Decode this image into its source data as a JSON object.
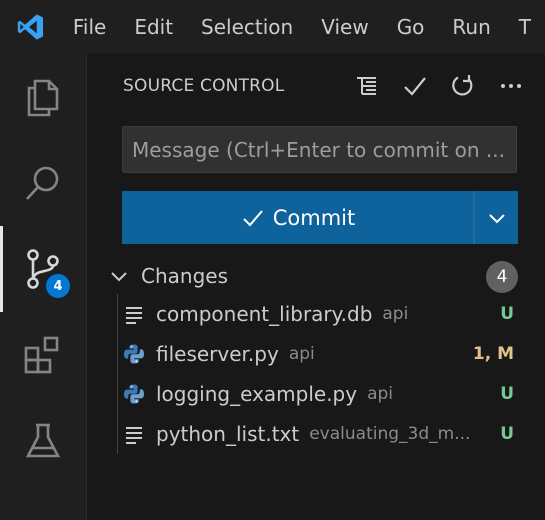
{
  "colors": {
    "accent": "#0e639c",
    "badge": "#0078d4",
    "untracked": "#73c991",
    "modified": "#e2c08d"
  },
  "menu": {
    "logo_icon": "vscode-logo-icon",
    "items": [
      "File",
      "Edit",
      "Selection",
      "View",
      "Go",
      "Run",
      "T"
    ]
  },
  "activity_bar": {
    "items": [
      {
        "icon": "files-icon"
      },
      {
        "icon": "search-icon"
      },
      {
        "icon": "source-control-icon",
        "badge": "4",
        "active": true
      },
      {
        "icon": "extensions-icon"
      },
      {
        "icon": "testing-icon"
      }
    ]
  },
  "sidebar": {
    "title": "SOURCE CONTROL",
    "tools": [
      "view-as-tree-icon",
      "commit-check-icon",
      "refresh-icon",
      "more-actions-icon"
    ],
    "message_placeholder": "Message (Ctrl+Enter to commit on ...",
    "commit_label": "Commit",
    "changes": {
      "label": "Changes",
      "count": "4",
      "files": [
        {
          "name": "component_library.db",
          "dir": "api",
          "status": "U",
          "icon": "text-file-icon"
        },
        {
          "name": "fileserver.py",
          "dir": "api",
          "status": "1, M",
          "icon": "python-file-icon"
        },
        {
          "name": "logging_example.py",
          "dir": "api",
          "status": "U",
          "icon": "python-file-icon"
        },
        {
          "name": "python_list.txt",
          "dir": "evaluating_3d_m...",
          "status": "U",
          "icon": "text-file-icon"
        }
      ]
    }
  }
}
